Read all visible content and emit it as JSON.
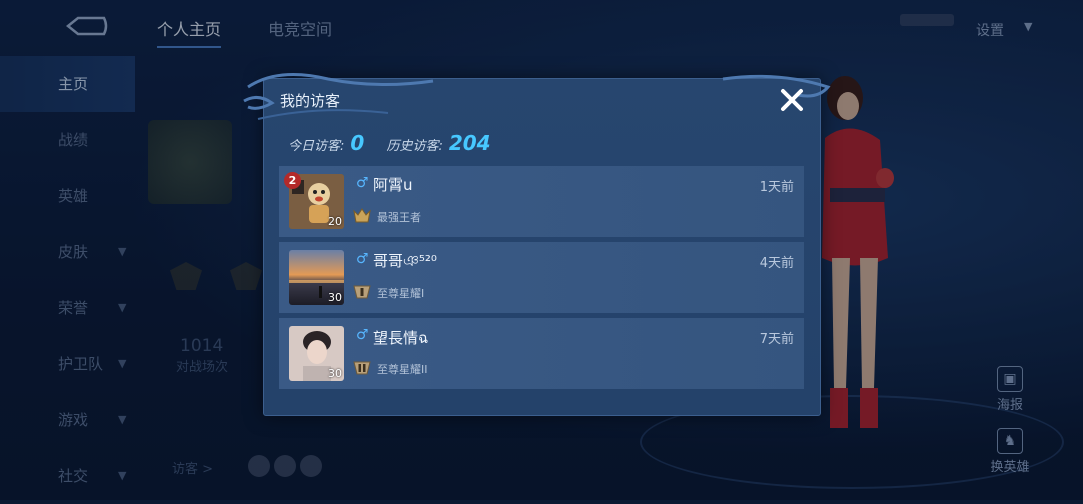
{
  "header": {
    "tabs": [
      {
        "label": "个人主页",
        "active": true
      },
      {
        "label": "电竞空间",
        "active": false
      }
    ],
    "settings_label": "设置"
  },
  "sidebar": {
    "items": [
      {
        "label": "主页",
        "active": true,
        "chevron": false
      },
      {
        "label": "战绩",
        "active": false,
        "chevron": false
      },
      {
        "label": "英雄",
        "active": false,
        "chevron": false
      },
      {
        "label": "皮肤",
        "active": false,
        "chevron": true
      },
      {
        "label": "荣誉",
        "active": false,
        "chevron": true
      },
      {
        "label": "护卫队",
        "active": false,
        "chevron": true
      },
      {
        "label": "游戏",
        "active": false,
        "chevron": true
      },
      {
        "label": "社交",
        "active": false,
        "chevron": true
      }
    ]
  },
  "background": {
    "match_count": "1014",
    "match_count_label": "对战场次",
    "visitors_link": "访客 >"
  },
  "right_panel": {
    "poster_label": "海报",
    "change_hero_label": "换英雄"
  },
  "modal": {
    "title": "我的访客",
    "today_label": "今日访客:",
    "today_count": "0",
    "history_label": "历史访客:",
    "history_count": "204",
    "visitors": [
      {
        "name": "阿霄u",
        "level": "20",
        "badge_count": "2",
        "time": "1天前",
        "rank": "最强王者",
        "avatar": "cartoon-figure"
      },
      {
        "name": "哥哥ঞ⁵²⁰",
        "level": "30",
        "badge_count": "",
        "time": "4天前",
        "rank": "至尊星耀I",
        "avatar": "sunset-lake"
      },
      {
        "name": "望長情ฉ",
        "level": "30",
        "badge_count": "",
        "time": "7天前",
        "rank": "至尊星耀II",
        "avatar": "portrait"
      }
    ]
  },
  "colors": {
    "accent": "#47c8ff",
    "gender_male": "#57b6ff",
    "modal_bg": "#27466f",
    "row_bg": "#3a5a86",
    "badge_red": "#b32a2a"
  }
}
